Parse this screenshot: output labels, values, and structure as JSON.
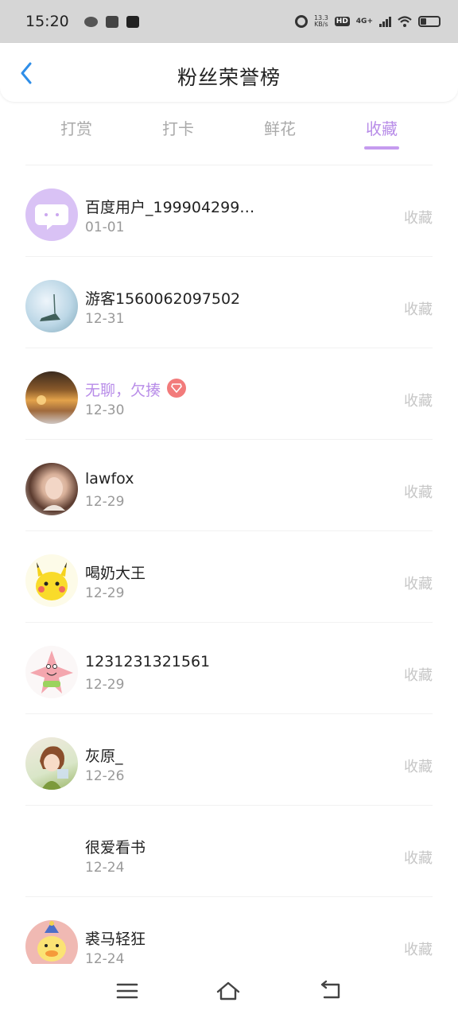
{
  "status_bar": {
    "time": "15:20",
    "net_speed_value": "13.3",
    "net_speed_unit": "KB/s",
    "hd_label": "HD",
    "network_label": "4G+",
    "icons": [
      "wechat-icon",
      "mail-icon",
      "tiktok-icon",
      "alarm-icon",
      "signal-icon",
      "wifi-icon",
      "battery-icon"
    ]
  },
  "header": {
    "title": "粉丝荣誉榜",
    "back_icon": "chevron-left-icon"
  },
  "tabs": [
    {
      "label": "打赏",
      "active": false
    },
    {
      "label": "打卡",
      "active": false
    },
    {
      "label": "鲜花",
      "active": false
    },
    {
      "label": "收藏",
      "active": true
    }
  ],
  "list": [
    {
      "name": "百度用户_199904299…",
      "date": "01-01",
      "action": "收藏",
      "avatar": "chat-bubble-icon",
      "vip": false
    },
    {
      "name": "游客1560062097502",
      "date": "12-31",
      "action": "收藏",
      "avatar": "landscape-photo",
      "vip": false
    },
    {
      "name": "无聊，欠揍",
      "date": "12-30",
      "action": "收藏",
      "avatar": "sunset-photo",
      "vip": true
    },
    {
      "name": "lawfox",
      "date": "12-29",
      "action": "收藏",
      "avatar": "portrait-photo",
      "vip": false
    },
    {
      "name": "喝奶大王",
      "date": "12-29",
      "action": "收藏",
      "avatar": "pikachu-photo",
      "vip": false
    },
    {
      "name": "1231231321561",
      "date": "12-29",
      "action": "收藏",
      "avatar": "patrick-star-photo",
      "vip": false
    },
    {
      "name": "灰原_",
      "date": "12-26",
      "action": "收藏",
      "avatar": "anime-girl-photo",
      "vip": false
    },
    {
      "name": "很爱看书",
      "date": "12-24",
      "action": "收藏",
      "avatar": "none",
      "vip": false
    },
    {
      "name": "裘马轻狂",
      "date": "12-24",
      "action": "收藏",
      "avatar": "duck-photo",
      "vip": false
    }
  ],
  "colors": {
    "accent": "#b88ce8",
    "indicator": "#c59bef",
    "vip_badge": "#f27b7b",
    "back_arrow": "#2f8ee8",
    "muted": "#999999",
    "action": "#c6c6c6"
  },
  "nav_bar": {
    "icons": [
      "menu-icon",
      "home-icon",
      "back-icon"
    ]
  }
}
